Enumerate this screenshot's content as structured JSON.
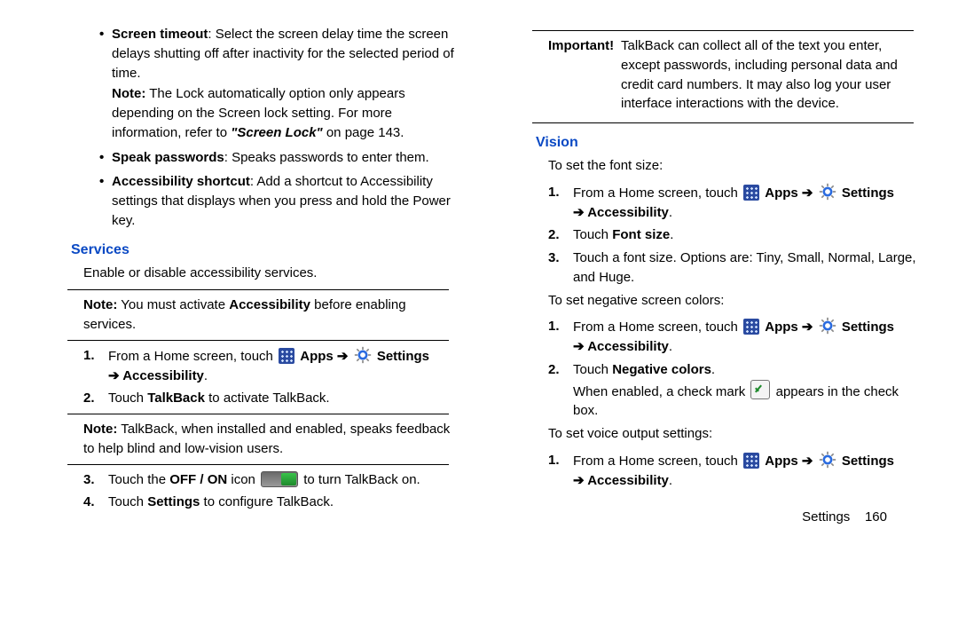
{
  "left": {
    "bullets": [
      {
        "title": "Screen timeout",
        "body": ": Select the screen delay time the screen delays shutting off after inactivity for the selected period of time.",
        "note_label": "Note:",
        "note_body1": " The Lock automatically option only appears depending on the Screen lock setting. For more information, refer to ",
        "note_ref": "\"Screen Lock\"",
        "note_body2": " on page 143."
      },
      {
        "title": "Speak passwords",
        "body": ": Speaks passwords to enter them."
      },
      {
        "title": "Accessibility shortcut",
        "body": ": Add a shortcut to Accessibility settings that displays when you press and hold the Power key."
      }
    ],
    "services_head": "Services",
    "services_intro": "Enable or disable accessibility services.",
    "note1_label": "Note:",
    "note1_a": " You must activate ",
    "note1_b": "Accessibility",
    "note1_c": " before enabling services.",
    "steps_a": [
      {
        "n": "1.",
        "pre": "From a Home screen, touch ",
        "apps": "Apps",
        "arrow": " ➔ ",
        "settings": "Settings",
        "arrow2": "➔ ",
        "acc": "Accessibility",
        "tail": "."
      },
      {
        "n": "2.",
        "pre": "Touch ",
        "b": "TalkBack",
        "tail": " to activate TalkBack."
      }
    ],
    "note2_label": "Note:",
    "note2_body": " TalkBack, when installed and enabled, speaks feedback to help blind and low-vision users.",
    "steps_b": [
      {
        "n": "3.",
        "pre": "Touch the ",
        "b": "OFF / ON",
        "mid": " icon ",
        "tail": " to turn TalkBack on."
      },
      {
        "n": "4.",
        "pre": "Touch ",
        "b": "Settings",
        "tail": " to configure TalkBack."
      }
    ]
  },
  "right": {
    "imp_label": "Important!",
    "imp_body": "TalkBack can collect all of the text you enter, except passwords, including personal data and credit card numbers. It may also log your user interface interactions with the device.",
    "vision_head": "Vision",
    "fontsize_intro": "To set the font size:",
    "neg_intro": "To set negative screen colors:",
    "voice_intro": "To set voice output settings:",
    "nav_apps": "Apps",
    "nav_settings": "Settings",
    "nav_acc": "Accessibility",
    "arrow": " ➔ ",
    "arrow2": "➔ ",
    "step_from": "From a Home screen, touch ",
    "fs2_a": "Touch ",
    "fs2_b": "Font size",
    "fs2_c": ".",
    "fs3": "Touch a font size. Options are: Tiny, Small, Normal, Large, and Huge.",
    "neg2_a": "Touch ",
    "neg2_b": "Negative colors",
    "neg2_c": ".",
    "neg_extra_a": "When enabled, a check mark ",
    "neg_extra_b": " appears in the check box.",
    "n1": "1.",
    "n2": "2.",
    "n3": "3."
  },
  "footer": {
    "section": "Settings",
    "page": "160"
  }
}
